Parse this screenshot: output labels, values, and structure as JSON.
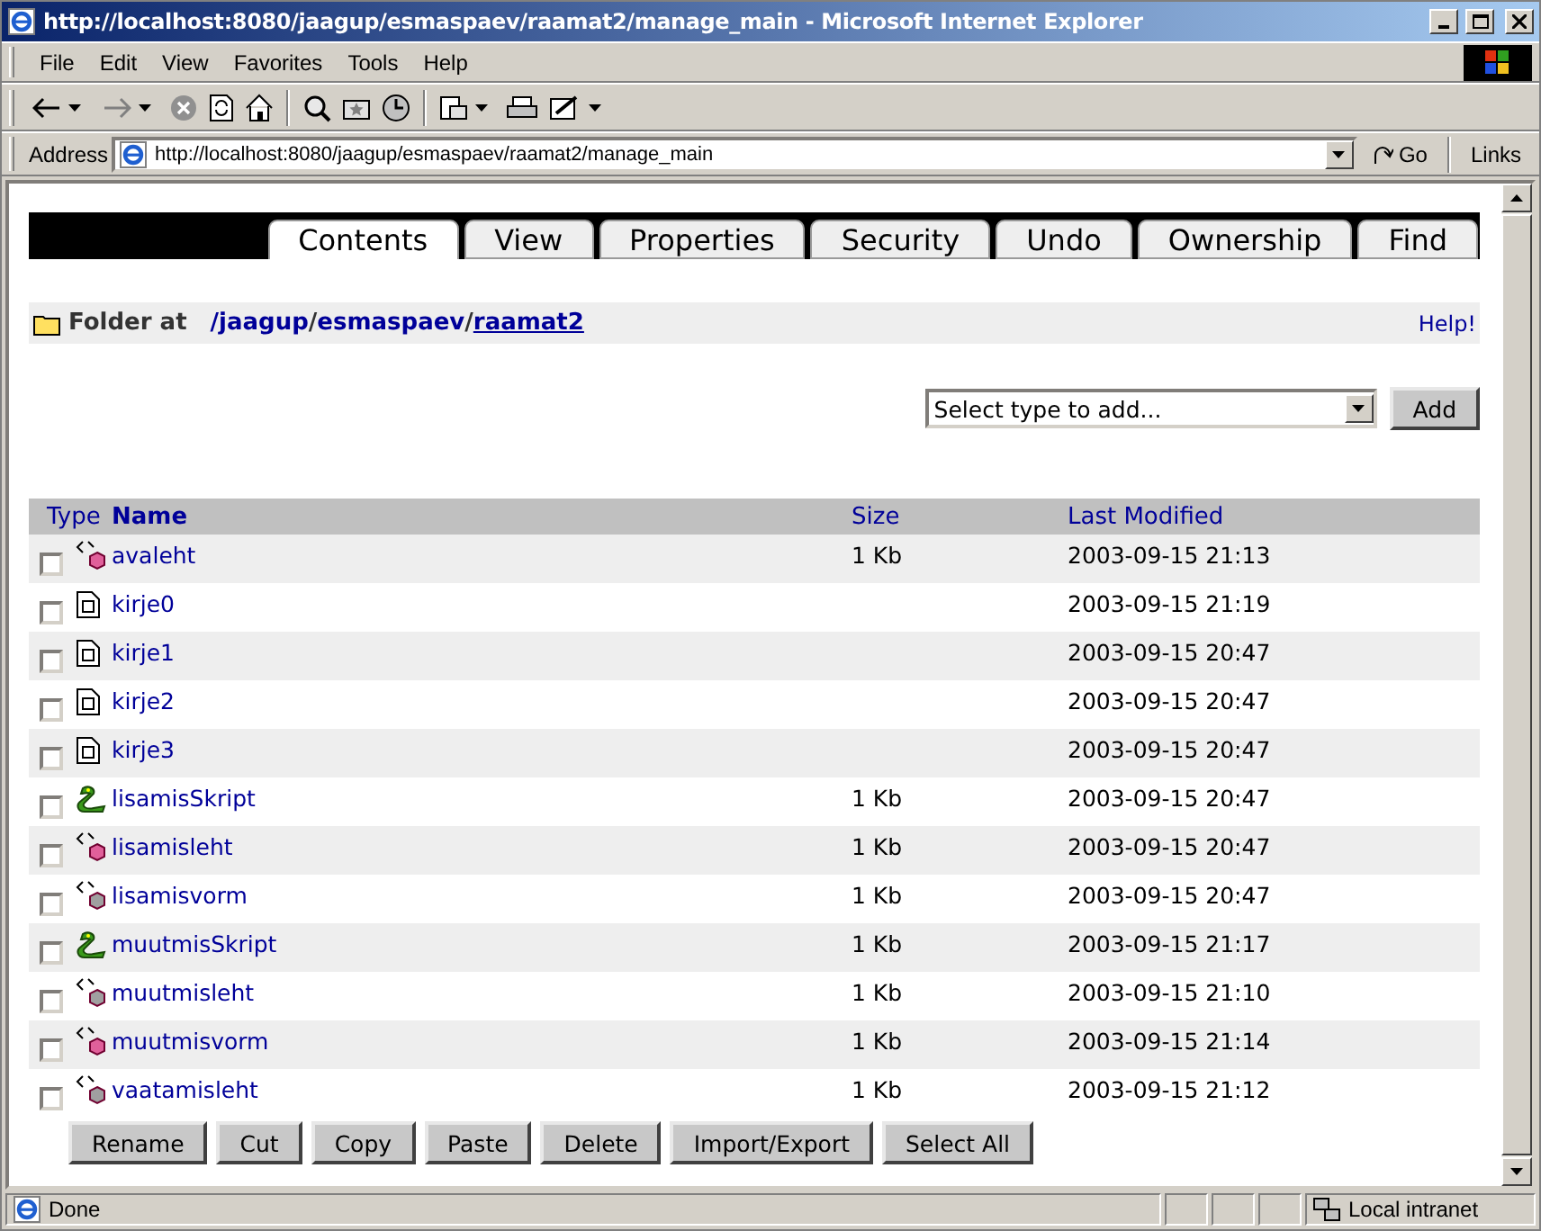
{
  "window": {
    "title": "http://localhost:8080/jaagup/esmaspaev/raamat2/manage_main - Microsoft Internet Explorer"
  },
  "menu": [
    "File",
    "Edit",
    "View",
    "Favorites",
    "Tools",
    "Help"
  ],
  "address_bar": {
    "label": "Address",
    "url": "http://localhost:8080/jaagup/esmaspaev/raamat2/manage_main",
    "go": "Go",
    "links": "Links"
  },
  "tabs": [
    {
      "label": "Contents",
      "selected": true
    },
    {
      "label": "View",
      "selected": false
    },
    {
      "label": "Properties",
      "selected": false
    },
    {
      "label": "Security",
      "selected": false
    },
    {
      "label": "Undo",
      "selected": false
    },
    {
      "label": "Ownership",
      "selected": false
    },
    {
      "label": "Find",
      "selected": false
    }
  ],
  "folder_bar": {
    "label": "Folder at",
    "path": [
      {
        "text": "/jaagup",
        "kind": "link"
      },
      {
        "text": "/",
        "kind": "separator"
      },
      {
        "text": "esmaspaev",
        "kind": "link"
      },
      {
        "text": "/",
        "kind": "separator"
      },
      {
        "text": "raamat2",
        "kind": "current"
      }
    ],
    "help": "Help!"
  },
  "add_control": {
    "placeholder": "Select type to add...",
    "button": "Add"
  },
  "table": {
    "columns": [
      "Type",
      "Name",
      "Size",
      "Last Modified"
    ],
    "rows": [
      {
        "kind": "method",
        "name": "avaleht",
        "size": "1 Kb",
        "modified": "2003-09-15 21:13",
        "checked": false
      },
      {
        "kind": "file",
        "name": "kirje0",
        "modified": "2003-09-15 21:19",
        "checked": false
      },
      {
        "kind": "file",
        "name": "kirje1",
        "modified": "2003-09-15 20:47",
        "checked": false
      },
      {
        "kind": "file",
        "name": "kirje2",
        "modified": "2003-09-15 20:47",
        "checked": false
      },
      {
        "kind": "file",
        "name": "kirje3",
        "modified": "2003-09-15 20:47",
        "checked": false
      },
      {
        "kind": "script",
        "name": "lisamisSkript",
        "size": "1 Kb",
        "modified": "2003-09-15 20:47",
        "checked": false
      },
      {
        "kind": "method",
        "name": "lisamisleht",
        "size": "1 Kb",
        "modified": "2003-09-15 20:47",
        "checked": false
      },
      {
        "kind": "template",
        "name": "lisamisvorm",
        "size": "1 Kb",
        "modified": "2003-09-15 20:47",
        "checked": false
      },
      {
        "kind": "script",
        "name": "muutmisSkript",
        "size": "1 Kb",
        "modified": "2003-09-15 21:17",
        "checked": false
      },
      {
        "kind": "template",
        "name": "muutmisleht",
        "size": "1 Kb",
        "modified": "2003-09-15 21:10",
        "checked": false
      },
      {
        "kind": "method",
        "name": "muutmisvorm",
        "size": "1 Kb",
        "modified": "2003-09-15 21:14",
        "checked": false
      },
      {
        "kind": "template",
        "name": "vaatamisleht",
        "size": "1 Kb",
        "modified": "2003-09-15 21:12",
        "checked": false
      }
    ]
  },
  "actions": [
    "Rename",
    "Cut",
    "Copy",
    "Paste",
    "Delete",
    "Import/Export",
    "Select All"
  ],
  "status_bar": {
    "text": "Done",
    "zone": "Local intranet"
  }
}
